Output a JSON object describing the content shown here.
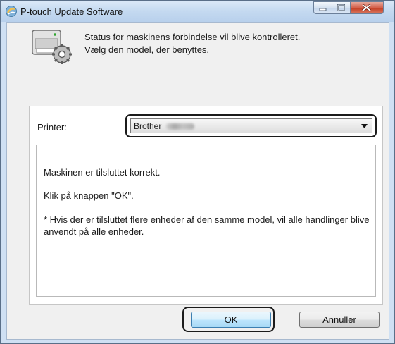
{
  "window": {
    "title": "P-touch Update Software",
    "buttons": {
      "minimize": "minimize-icon",
      "maximize": "maximize-icon",
      "close": "close-icon"
    }
  },
  "header": {
    "icon": "printer-gear-icon",
    "status_line1": "Status for maskinens forbindelse vil blive kontrolleret.",
    "status_line2": "Vælg den model, der benyttes."
  },
  "printer": {
    "label": "Printer:",
    "selected_value": "Brother"
  },
  "messages": {
    "connected": "Maskinen er tilsluttet korrekt.",
    "click_ok": "Klik på knappen \"OK\".",
    "note": "* Hvis der er tilsluttet flere enheder af den samme model, vil alle handlinger blive anvendt på alle enheder."
  },
  "footer": {
    "ok_label": "OK",
    "cancel_label": "Annuller"
  },
  "colors": {
    "titlebar": "#c4d9f0",
    "close_button": "#c23c22",
    "highlight_outline": "#1b1b1b",
    "default_button_border": "#3c7fb1"
  }
}
